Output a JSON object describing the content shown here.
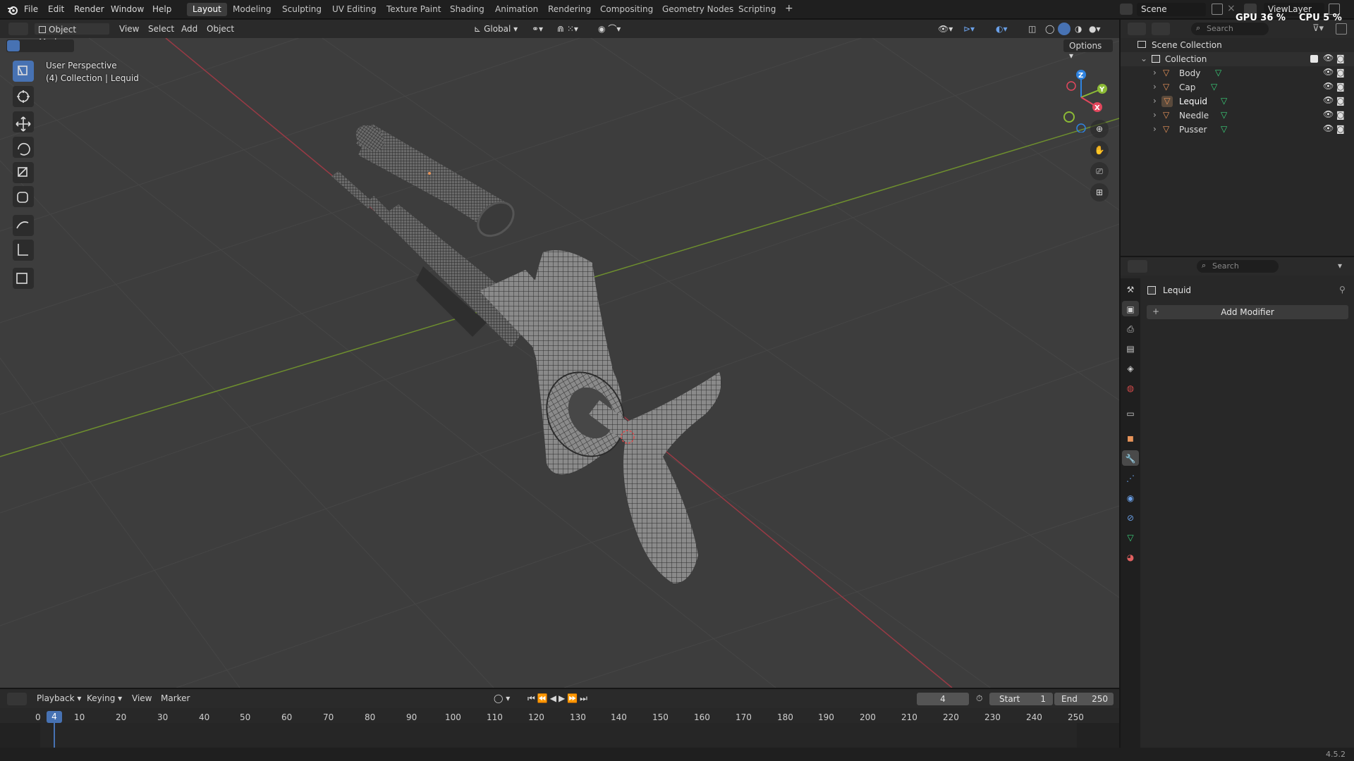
{
  "topbar": {
    "menus": [
      "File",
      "Edit",
      "Render",
      "Window",
      "Help"
    ],
    "workspaces": [
      "Layout",
      "Modeling",
      "Sculpting",
      "UV Editing",
      "Texture Paint",
      "Shading",
      "Animation",
      "Rendering",
      "Compositing",
      "Geometry Nodes",
      "Scripting"
    ],
    "active_workspace": "Layout",
    "add_tab": "+",
    "scene": "Scene",
    "view_layer": "ViewLayer",
    "gpu_label": "GPU",
    "gpu_value": "36 %",
    "cpu_label": "CPU",
    "cpu_value": "5 %"
  },
  "viewport": {
    "mode": "Object Mode",
    "menus": [
      "View",
      "Select",
      "Add",
      "Object"
    ],
    "orientation": "Global",
    "options": "Options",
    "overlay_line1": "User Perspective",
    "overlay_line2": "(4) Collection | Lequid",
    "gizmo": {
      "z": "Z",
      "y": "Y",
      "x": "X"
    }
  },
  "outliner": {
    "search_placeholder": "Search",
    "scene_collection": "Scene Collection",
    "collection": "Collection",
    "objects": [
      "Body",
      "Cap",
      "Lequid",
      "Needle",
      "Pusser"
    ]
  },
  "properties": {
    "search_placeholder": "Search",
    "object_name": "Lequid",
    "add_modifier": "Add Modifier"
  },
  "timeline": {
    "menus": [
      "Playback",
      "Keying",
      "View",
      "Marker"
    ],
    "current_frame": "4",
    "start_label": "Start",
    "start_value": "1",
    "end_label": "End",
    "end_value": "250",
    "ruler": [
      "0",
      "10",
      "20",
      "30",
      "40",
      "50",
      "60",
      "70",
      "80",
      "90",
      "100",
      "110",
      "120",
      "130",
      "140",
      "150",
      "160",
      "170",
      "180",
      "190",
      "200",
      "210",
      "220",
      "230",
      "240",
      "250"
    ],
    "playhead": "4"
  },
  "statusbar": {
    "version": "4.5.2"
  },
  "colors": {
    "accent": "#4772b3",
    "x_axis": "#e2475d",
    "y_axis": "#8cba36",
    "z_axis": "#2f83e0",
    "mesh_icon": "#e8945a",
    "data_icon": "#3ad07a"
  }
}
